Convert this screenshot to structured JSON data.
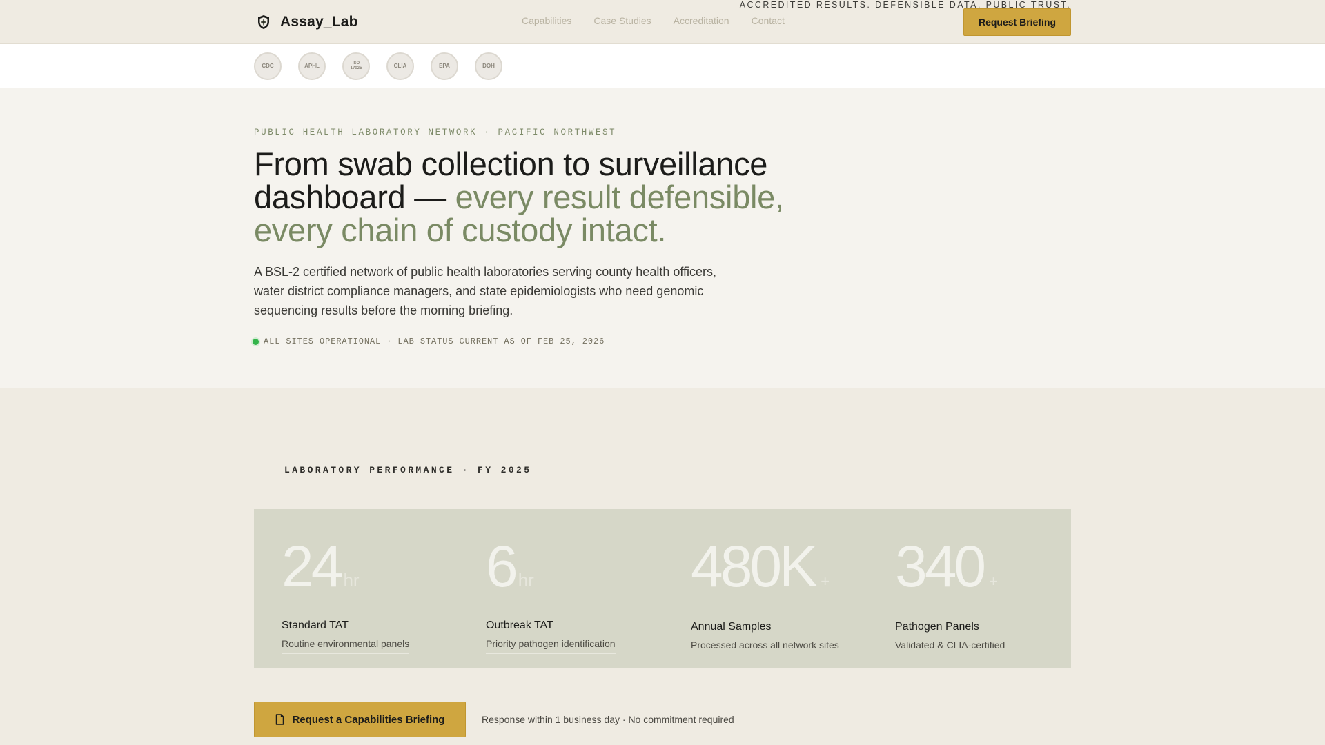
{
  "brand": {
    "name": "Assay_Lab"
  },
  "nav": {
    "items": [
      {
        "label": "Capabilities"
      },
      {
        "label": "Case Studies"
      },
      {
        "label": "Accreditation"
      },
      {
        "label": "Contact"
      }
    ],
    "cta_label": "Request Briefing"
  },
  "accreditation": {
    "badges": [
      {
        "label": "CDC"
      },
      {
        "label": "APHL"
      },
      {
        "label": "ISO\n17025"
      },
      {
        "label": "CLIA"
      },
      {
        "label": "EPA"
      },
      {
        "label": "DOH"
      }
    ],
    "tagline": "ACCREDITED RESULTS. DEFENSIBLE DATA. PUBLIC TRUST."
  },
  "hero": {
    "eyebrow": "PUBLIC HEALTH LABORATORY NETWORK · PACIFIC NORTHWEST",
    "headline_main": "From swab collection to surveillance dashboard — ",
    "headline_accent": "every result defensible, every chain of custody intact.",
    "lead": "A BSL-2 certified network of public health laboratories serving county health officers, water district compliance managers, and state epidemiologists who need genomic sequencing results before the morning briefing.",
    "status": "ALL SITES OPERATIONAL · LAB STATUS CURRENT AS OF FEB 25, 2026"
  },
  "performance": {
    "title": "LABORATORY PERFORMANCE · FY 2025",
    "stats": [
      {
        "value": "24",
        "unit": "hr",
        "label": "Standard TAT",
        "desc": "Routine environmental panels"
      },
      {
        "value": "6",
        "unit": "hr",
        "label": "Outbreak TAT",
        "desc": "Priority pathogen identification"
      },
      {
        "value": "480K",
        "unit": "+",
        "label": "Annual Samples",
        "desc": "Processed across all network sites"
      },
      {
        "value": "340",
        "unit": "+",
        "label": "Pathogen Panels",
        "desc": "Validated & CLIA-certified"
      }
    ]
  },
  "cta": {
    "label": "Request a Capabilities Briefing",
    "note": "Response within 1 business day · No commitment required"
  },
  "colors": {
    "accent_gold": "#cfa640",
    "accent_sage": "#7a8a64",
    "status_green": "#34b44a"
  }
}
